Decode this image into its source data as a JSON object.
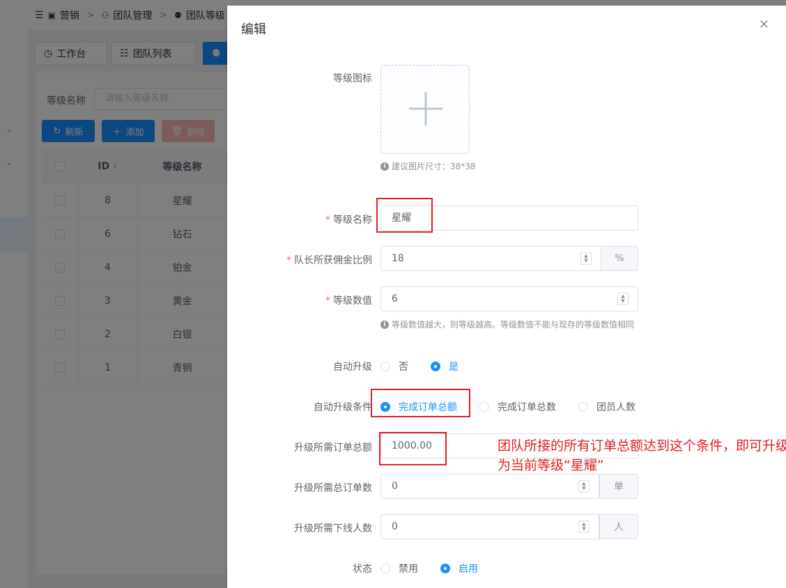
{
  "breadcrumb": [
    "营销",
    "团队管理",
    "团队等级"
  ],
  "tabs": [
    {
      "label": "工作台"
    },
    {
      "label": "团队列表"
    },
    {
      "label": ""
    }
  ],
  "search": {
    "label": "等级名称",
    "placeholder": "请输入等级名称"
  },
  "toolbar": {
    "refresh": "刷新",
    "add": "添加",
    "delete": "删除"
  },
  "table": {
    "headers": [
      "ID",
      "等级名称"
    ],
    "rows": [
      {
        "id": "8",
        "name": "星耀"
      },
      {
        "id": "6",
        "name": "钻石"
      },
      {
        "id": "4",
        "name": "铂金"
      },
      {
        "id": "3",
        "name": "黄金"
      },
      {
        "id": "2",
        "name": "白银"
      },
      {
        "id": "1",
        "name": "青铜"
      }
    ]
  },
  "dialog": {
    "title": "编辑",
    "icon_label": "等级图标",
    "icon_tip": "建议图片尺寸：38*38",
    "name_label": "等级名称",
    "name_value": "星耀",
    "ratio_label": "队长所获佣金比例",
    "ratio_value": "18",
    "ratio_unit": "%",
    "level_label": "等级数值",
    "level_value": "6",
    "level_tip": "等级数值越大，则等级越高。等级数值不能与现存的等级数值相同",
    "auto_label": "自动升级",
    "auto_no": "否",
    "auto_yes": "是",
    "cond_label": "自动升级条件",
    "cond_opt1": "完成订单总额",
    "cond_opt2": "完成订单总数",
    "cond_opt3": "团员人数",
    "amount_label": "升级所需订单总额",
    "amount_value": "1000.00",
    "orders_label": "升级所需总订单数",
    "orders_value": "0",
    "orders_unit": "单",
    "members_label": "升级所需下线人数",
    "members_value": "0",
    "members_unit": "人",
    "status_label": "状态",
    "status_off": "禁用",
    "status_on": "启用"
  },
  "annotation": {
    "text": "团队所接的所有订单总额达到这个条件，即可升级为当前等级“星耀”"
  },
  "colors": {
    "primary": "#1890ff",
    "danger": "#f56c6c",
    "annotation": "#e02020"
  }
}
